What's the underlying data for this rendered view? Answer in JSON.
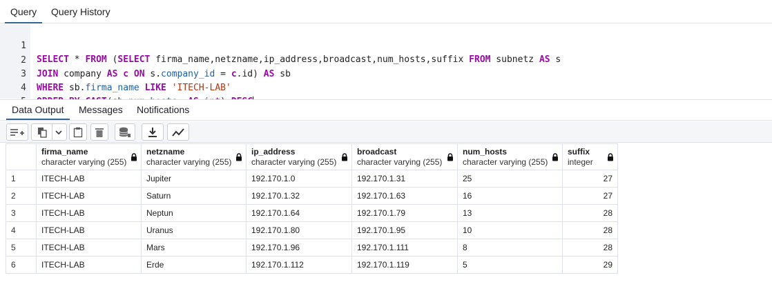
{
  "top_tabs": [
    {
      "label": "Query",
      "active": true
    },
    {
      "label": "Query History",
      "active": false
    }
  ],
  "editor": {
    "lines": [
      {
        "num": "1",
        "tokens": [
          {
            "t": "SELECT",
            "c": "kw"
          },
          {
            "t": " * ",
            "c": "plain"
          },
          {
            "t": "FROM",
            "c": "kw"
          },
          {
            "t": " (",
            "c": "plain"
          },
          {
            "t": "SELECT",
            "c": "kw"
          },
          {
            "t": " firma_name,netzname,ip_address,broadcast,num_hosts,suffix ",
            "c": "plain"
          },
          {
            "t": "FROM",
            "c": "kw"
          },
          {
            "t": " subnetz ",
            "c": "plain"
          },
          {
            "t": "AS",
            "c": "kw"
          },
          {
            "t": " s",
            "c": "plain"
          }
        ]
      },
      {
        "num": "2",
        "tokens": [
          {
            "t": "JOIN",
            "c": "kw"
          },
          {
            "t": " company ",
            "c": "plain"
          },
          {
            "t": "AS",
            "c": "kw"
          },
          {
            "t": " ",
            "c": "plain"
          },
          {
            "t": "c",
            "c": "kw"
          },
          {
            "t": " ",
            "c": "plain"
          },
          {
            "t": "ON",
            "c": "kw"
          },
          {
            "t": " s.",
            "c": "plain"
          },
          {
            "t": "company_id",
            "c": "col"
          },
          {
            "t": " = ",
            "c": "plain"
          },
          {
            "t": "c",
            "c": "kw"
          },
          {
            "t": ".id) ",
            "c": "plain"
          },
          {
            "t": "AS",
            "c": "kw"
          },
          {
            "t": " sb",
            "c": "plain"
          }
        ]
      },
      {
        "num": "3",
        "tokens": [
          {
            "t": "WHERE",
            "c": "kw"
          },
          {
            "t": " sb.",
            "c": "plain"
          },
          {
            "t": "firma_name",
            "c": "col"
          },
          {
            "t": " ",
            "c": "plain"
          },
          {
            "t": "LIKE",
            "c": "kw"
          },
          {
            "t": " ",
            "c": "plain"
          },
          {
            "t": "'ITECH-LAB'",
            "c": "str"
          }
        ]
      },
      {
        "num": "4",
        "tokens": [
          {
            "t": "ORDER BY",
            "c": "kw"
          },
          {
            "t": " ",
            "c": "plain"
          },
          {
            "t": "CAST",
            "c": "kw"
          },
          {
            "t": "(sb.",
            "c": "plain"
          },
          {
            "t": "num_hosts",
            "c": "col"
          },
          {
            "t": "  ",
            "c": "plain"
          },
          {
            "t": "AS",
            "c": "kw"
          },
          {
            "t": " ",
            "c": "plain"
          },
          {
            "t": "int",
            "c": "fn"
          },
          {
            "t": ") ",
            "c": "plain"
          },
          {
            "t": "DESC",
            "c": "kw"
          }
        ],
        "cursor": true
      },
      {
        "num": "5",
        "tokens": []
      }
    ]
  },
  "panel_tabs": [
    {
      "label": "Data Output",
      "active": true
    },
    {
      "label": "Messages",
      "active": false
    },
    {
      "label": "Notifications",
      "active": false
    }
  ],
  "toolbar": {
    "buttons": [
      "add-row-icon",
      "copy-icon",
      "chevron-down-icon",
      "paste-icon",
      "delete-icon",
      "save-data-icon",
      "download-icon",
      "graph-icon"
    ]
  },
  "grid": {
    "columns": [
      {
        "name": "firma_name",
        "type": "character varying (255)"
      },
      {
        "name": "netzname",
        "type": "character varying (255)"
      },
      {
        "name": "ip_address",
        "type": "character varying (255)"
      },
      {
        "name": "broadcast",
        "type": "character varying (255)"
      },
      {
        "name": "num_hosts",
        "type": "character varying (255)"
      },
      {
        "name": "suffix",
        "type": "integer"
      }
    ],
    "rows": [
      {
        "n": "1",
        "cells": [
          "ITECH-LAB",
          "Jupiter",
          "192.170.1.0",
          "192.170.1.31",
          "25",
          "27"
        ]
      },
      {
        "n": "2",
        "cells": [
          "ITECH-LAB",
          "Saturn",
          "192.170.1.32",
          "192.170.1.63",
          "16",
          "27"
        ]
      },
      {
        "n": "3",
        "cells": [
          "ITECH-LAB",
          "Neptun",
          "192.170.1.64",
          "192.170.1.79",
          "13",
          "28"
        ]
      },
      {
        "n": "4",
        "cells": [
          "ITECH-LAB",
          "Uranus",
          "192.170.1.80",
          "192.170.1.95",
          "10",
          "28"
        ]
      },
      {
        "n": "5",
        "cells": [
          "ITECH-LAB",
          "Mars",
          "192.170.1.96",
          "192.170.1.111",
          "8",
          "28"
        ]
      },
      {
        "n": "6",
        "cells": [
          "ITECH-LAB",
          "Erde",
          "192.170.1.112",
          "192.170.1.119",
          "5",
          "29"
        ]
      }
    ]
  }
}
